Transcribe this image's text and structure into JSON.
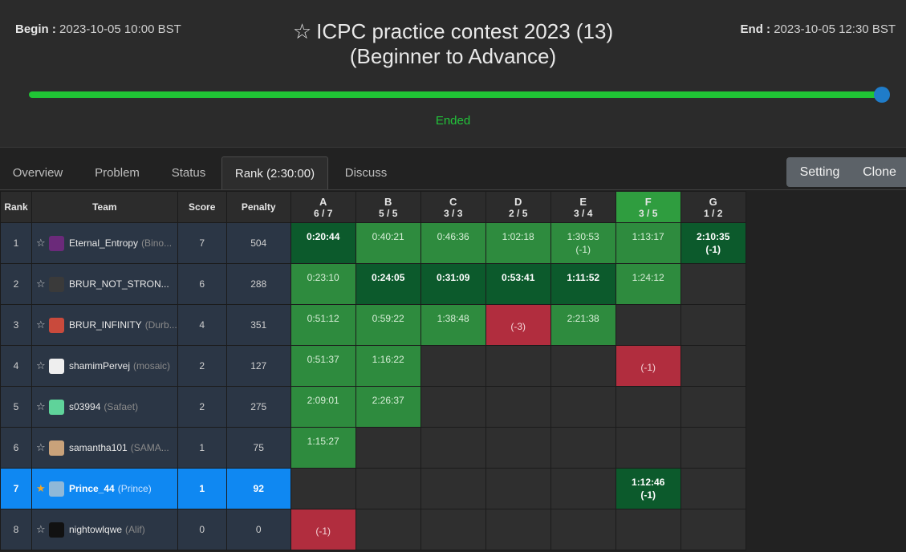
{
  "header": {
    "begin_label": "Begin :",
    "begin_value": "2023-10-05 10:00 BST",
    "end_label": "End :",
    "end_value": "2023-10-05 12:30 BST",
    "title_line1": "ICPC practice contest 2023 (13)",
    "title_line2": "(Beginner to Advance)",
    "status": "Ended",
    "progress": 1.0,
    "star_icon": "star-outline-icon"
  },
  "tabs": [
    "Overview",
    "Problem",
    "Status",
    "Rank (2:30:00)",
    "Discuss"
  ],
  "active_tab": 3,
  "buttons": {
    "setting": "Setting",
    "clone": "Clone"
  },
  "table": {
    "headers": {
      "rank": "Rank",
      "team": "Team",
      "score": "Score",
      "penalty": "Penalty"
    },
    "problems": [
      {
        "name": "A",
        "stat": "6 / 7"
      },
      {
        "name": "B",
        "stat": "5 / 5"
      },
      {
        "name": "C",
        "stat": "3 / 3"
      },
      {
        "name": "D",
        "stat": "2 / 5"
      },
      {
        "name": "E",
        "stat": "3 / 4"
      },
      {
        "name": "F",
        "stat": "3 / 5"
      },
      {
        "name": "G",
        "stat": "1 / 2"
      }
    ],
    "rows": [
      {
        "rank": "1",
        "name": "Eternal_Entropy",
        "sub": "(Bino...",
        "score": "7",
        "penalty": "504",
        "cells": [
          [
            "first",
            "0:20:44",
            ""
          ],
          [
            "solved",
            "0:40:21",
            ""
          ],
          [
            "solved",
            "0:46:36",
            ""
          ],
          [
            "solved",
            "1:02:18",
            ""
          ],
          [
            "solved",
            "1:30:53",
            "(-1)"
          ],
          [
            "solved",
            "1:13:17",
            ""
          ],
          [
            "first",
            "2:10:35",
            "(-1)"
          ]
        ]
      },
      {
        "rank": "2",
        "name": "BRUR_NOT_STRON...",
        "sub": "",
        "score": "6",
        "penalty": "288",
        "cells": [
          [
            "solved",
            "0:23:10",
            ""
          ],
          [
            "first",
            "0:24:05",
            ""
          ],
          [
            "first",
            "0:31:09",
            ""
          ],
          [
            "first",
            "0:53:41",
            ""
          ],
          [
            "first",
            "1:11:52",
            ""
          ],
          [
            "solved",
            "1:24:12",
            ""
          ],
          [
            "empty",
            "",
            ""
          ]
        ]
      },
      {
        "rank": "3",
        "name": "BRUR_INFINITY",
        "sub": "(Durb...",
        "score": "4",
        "penalty": "351",
        "cells": [
          [
            "solved",
            "0:51:12",
            ""
          ],
          [
            "solved",
            "0:59:22",
            ""
          ],
          [
            "solved",
            "1:38:48",
            ""
          ],
          [
            "failed",
            "(-3)",
            ""
          ],
          [
            "solved",
            "2:21:38",
            ""
          ],
          [
            "empty",
            "",
            ""
          ],
          [
            "empty",
            "",
            ""
          ]
        ]
      },
      {
        "rank": "4",
        "name": "shamimPervej",
        "sub": "(mosaic)",
        "score": "2",
        "penalty": "127",
        "cells": [
          [
            "solved",
            "0:51:37",
            ""
          ],
          [
            "solved",
            "1:16:22",
            ""
          ],
          [
            "empty",
            "",
            ""
          ],
          [
            "empty",
            "",
            ""
          ],
          [
            "empty",
            "",
            ""
          ],
          [
            "failed",
            "(-1)",
            ""
          ],
          [
            "empty",
            "",
            ""
          ]
        ]
      },
      {
        "rank": "5",
        "name": "s03994",
        "sub": "(Safaet)",
        "score": "2",
        "penalty": "275",
        "cells": [
          [
            "solved",
            "2:09:01",
            ""
          ],
          [
            "solved",
            "2:26:37",
            ""
          ],
          [
            "empty",
            "",
            ""
          ],
          [
            "empty",
            "",
            ""
          ],
          [
            "empty",
            "",
            ""
          ],
          [
            "empty",
            "",
            ""
          ],
          [
            "empty",
            "",
            ""
          ]
        ]
      },
      {
        "rank": "6",
        "name": "samantha101",
        "sub": "(SAMA...",
        "score": "1",
        "penalty": "75",
        "cells": [
          [
            "solved",
            "1:15:27",
            ""
          ],
          [
            "empty",
            "",
            ""
          ],
          [
            "empty",
            "",
            ""
          ],
          [
            "empty",
            "",
            ""
          ],
          [
            "empty",
            "",
            ""
          ],
          [
            "empty",
            "",
            ""
          ],
          [
            "empty",
            "",
            ""
          ]
        ]
      },
      {
        "rank": "7",
        "name": "Prince_44",
        "sub": "(Prince)",
        "score": "1",
        "penalty": "92",
        "me": true,
        "cells": [
          [
            "empty",
            "",
            ""
          ],
          [
            "empty",
            "",
            ""
          ],
          [
            "empty",
            "",
            ""
          ],
          [
            "empty",
            "",
            ""
          ],
          [
            "empty",
            "",
            ""
          ],
          [
            "first",
            "1:12:46",
            "(-1)"
          ],
          [
            "empty",
            "",
            ""
          ]
        ]
      },
      {
        "rank": "8",
        "name": "nightowlqwe",
        "sub": "(Alif)",
        "score": "0",
        "penalty": "0",
        "cells": [
          [
            "failed",
            "(-1)",
            ""
          ],
          [
            "empty",
            "",
            ""
          ],
          [
            "empty",
            "",
            ""
          ],
          [
            "empty",
            "",
            ""
          ],
          [
            "empty",
            "",
            ""
          ],
          [
            "empty",
            "",
            ""
          ],
          [
            "empty",
            "",
            ""
          ]
        ]
      }
    ]
  },
  "colors": {
    "solved": "#2e8b3e",
    "first_solve": "#0c5a2c",
    "failed": "#b12d3e",
    "highlight_row": "#0f88f2",
    "progress": "#20c535"
  }
}
